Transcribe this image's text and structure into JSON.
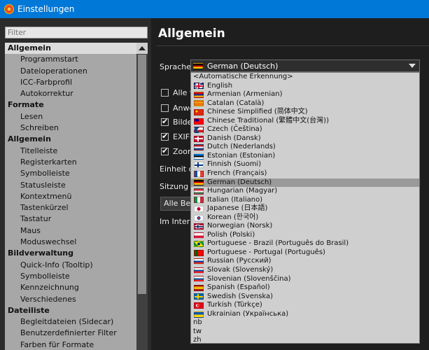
{
  "window": {
    "title": "Einstellungen"
  },
  "sidebar": {
    "filter_placeholder": "Filter",
    "items": [
      {
        "label": "Allgemein",
        "type": "cat",
        "selected": true
      },
      {
        "label": "Programmstart",
        "type": "sub"
      },
      {
        "label": "Dateioperationen",
        "type": "sub"
      },
      {
        "label": "ICC-Farbprofil",
        "type": "sub"
      },
      {
        "label": "Autokorrektur",
        "type": "sub"
      },
      {
        "label": "Formate",
        "type": "cat"
      },
      {
        "label": "Lesen",
        "type": "sub"
      },
      {
        "label": "Schreiben",
        "type": "sub"
      },
      {
        "label": "Allgemein",
        "type": "cat"
      },
      {
        "label": "Titelleiste",
        "type": "sub"
      },
      {
        "label": "Registerkarten",
        "type": "sub"
      },
      {
        "label": "Symbolleiste",
        "type": "sub"
      },
      {
        "label": "Statusleiste",
        "type": "sub"
      },
      {
        "label": "Kontextmenü",
        "type": "sub"
      },
      {
        "label": "Tastenkürzel",
        "type": "sub"
      },
      {
        "label": "Tastatur",
        "type": "sub"
      },
      {
        "label": "Maus",
        "type": "sub"
      },
      {
        "label": "Moduswechsel",
        "type": "sub"
      },
      {
        "label": "Bildverwaltung",
        "type": "cat"
      },
      {
        "label": "Quick-Info (Tooltip)",
        "type": "sub"
      },
      {
        "label": "Symbolleiste",
        "type": "sub"
      },
      {
        "label": "Kennzeichnung",
        "type": "sub"
      },
      {
        "label": "Verschiedenes",
        "type": "sub"
      },
      {
        "label": "Dateiliste",
        "type": "cat"
      },
      {
        "label": "Begleitdateien (Sidecar)",
        "type": "sub"
      },
      {
        "label": "Benutzerdefinierter Filter",
        "type": "sub"
      },
      {
        "label": "Farben für Formate",
        "type": "sub"
      }
    ]
  },
  "main": {
    "title": "Allgemein",
    "language_label": "Sprache",
    "language_value": "German (Deutsch)",
    "language_value_flag": "de",
    "checkbox_rows": [
      {
        "label": "Alle v",
        "checked": false
      },
      {
        "label": "Anwe",
        "checked": false
      },
      {
        "label": "Bilder",
        "checked": true
      },
      {
        "label": "EXIF-",
        "checked": true
      },
      {
        "label": "Zoom",
        "checked": true
      }
    ],
    "unit_label": "Einheit de",
    "session_label": "Sitzung be",
    "session_button": "Alle Bes",
    "internet_label": "Im Intern"
  },
  "dropdown": {
    "options": [
      {
        "label": "<Automatische Erkennung>",
        "flag": ""
      },
      {
        "label": "English",
        "flag": "gb"
      },
      {
        "label": "Armenian (Armenian)",
        "flag": "am"
      },
      {
        "label": "Catalan (Català)",
        "flag": "ca"
      },
      {
        "label": "Chinese Simplified (简体中文)",
        "flag": "cn"
      },
      {
        "label": "Chinese Traditional (繁體中文(台灣))",
        "flag": "tw"
      },
      {
        "label": "Czech (Čeština)",
        "flag": "cz"
      },
      {
        "label": "Danish (Dansk)",
        "flag": "dk"
      },
      {
        "label": "Dutch (Nederlands)",
        "flag": "nl"
      },
      {
        "label": "Estonian (Estonian)",
        "flag": "ee"
      },
      {
        "label": "Finnish (Suomi)",
        "flag": "fi"
      },
      {
        "label": "French (Français)",
        "flag": "fr"
      },
      {
        "label": "German (Deutsch)",
        "flag": "de",
        "selected": true
      },
      {
        "label": "Hungarian (Magyar)",
        "flag": "hu"
      },
      {
        "label": "Italian (Italiano)",
        "flag": "it"
      },
      {
        "label": "Japanese (日本語)",
        "flag": "jp"
      },
      {
        "label": "Korean (한국어)",
        "flag": "kr"
      },
      {
        "label": "Norwegian (Norsk)",
        "flag": "no"
      },
      {
        "label": "Polish (Polski)",
        "flag": "pl"
      },
      {
        "label": "Portuguese - Brazil (Português do Brasil)",
        "flag": "br"
      },
      {
        "label": "Portuguese - Portugal (Português)",
        "flag": "pt"
      },
      {
        "label": "Russian (Русский)",
        "flag": "ru"
      },
      {
        "label": "Slovak (Slovenský)",
        "flag": "sk"
      },
      {
        "label": "Slovenian (Slovenščina)",
        "flag": "si"
      },
      {
        "label": "Spanish (Español)",
        "flag": "es"
      },
      {
        "label": "Swedish (Svenska)",
        "flag": "se"
      },
      {
        "label": "Turkish (Türkçe)",
        "flag": "tr"
      },
      {
        "label": "Ukrainian (Українська)",
        "flag": "ua"
      },
      {
        "label": "nb",
        "flag": ""
      },
      {
        "label": "tw",
        "flag": ""
      },
      {
        "label": "zh",
        "flag": ""
      }
    ]
  },
  "colors": {
    "titlebar": "#0078d7",
    "background": "#1e1e1e",
    "sidebar_tree": "#a7a7a7",
    "dropdown_bg": "#cfcfcf",
    "dropdown_selected": "#9a9a9a"
  }
}
